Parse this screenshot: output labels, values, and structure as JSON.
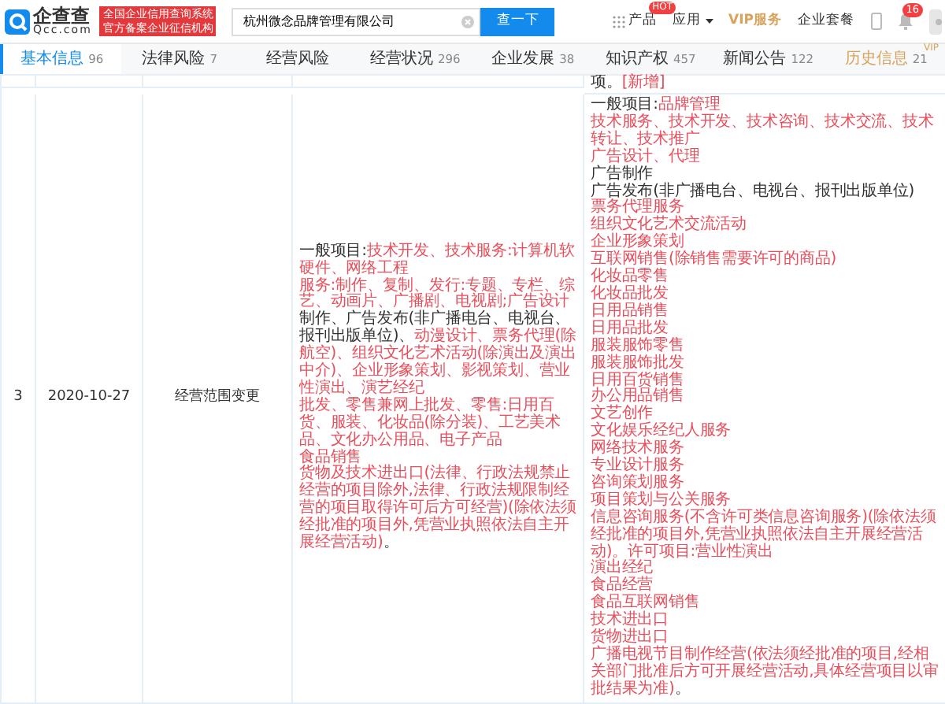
{
  "header": {
    "logo": {
      "name": "企查查",
      "domain": "Qcc.com"
    },
    "slogan": [
      "全国企业信用查询系统",
      "官方备案企业征信机构"
    ],
    "search": {
      "value": "杭州微念品牌管理有限公司",
      "button": "查一下"
    },
    "nav": [
      {
        "kind": "product",
        "label": "产品",
        "badge": "HOT"
      },
      {
        "kind": "dropdown",
        "label": "应用"
      },
      {
        "kind": "vip",
        "label": "VIP服务"
      },
      {
        "kind": "plain",
        "label": "企业套餐"
      }
    ],
    "notifications": "16"
  },
  "tabs": [
    {
      "label": "基本信息",
      "count": "96",
      "selected": true,
      "vip": false
    },
    {
      "label": "法律风险",
      "count": "7",
      "selected": false,
      "vip": false
    },
    {
      "label": "经营风险",
      "selected": false,
      "vip": false
    },
    {
      "label": "经营状况",
      "count": "296",
      "selected": false,
      "vip": false
    },
    {
      "label": "企业发展",
      "count": "38",
      "selected": false,
      "vip": false
    },
    {
      "label": "知识产权",
      "count": "457",
      "selected": false,
      "vip": false
    },
    {
      "label": "新闻公告",
      "count": "122",
      "selected": false,
      "vip": false
    },
    {
      "label": "历史信息",
      "count": "21",
      "selected": false,
      "vip": true,
      "badge": "VIP"
    }
  ],
  "table": {
    "previous_row": {
      "after": [
        [
          {
            "text": "项。",
            "changed": false
          },
          {
            "text": "[新增]",
            "changed": true
          }
        ]
      ]
    },
    "rows": [
      {
        "index": "3",
        "date": "2020-10-27",
        "type": "经营范围变更",
        "before": [
          [
            {
              "text": "一般项目:",
              "changed": false
            },
            {
              "text": "技术开发、技术服务:计算机软硬件、网络工程",
              "changed": true
            }
          ],
          [
            {
              "text": "服务:制作、复制、发行:专题、专栏、综艺、动画片、广播剧、电视剧;广告设计",
              "changed": true
            },
            {
              "text": "制作、广告发布(非广播电台、电视台、报刊出版单位)、",
              "changed": false
            },
            {
              "text": "动漫设计、票务代理(除航空)、组织文化艺术活动(除演出及演出中介)、企业形象策划、影视策划、营业性演出、演艺经纪",
              "changed": true
            }
          ],
          [
            {
              "text": "批发、零售兼网上批发、零售:日用百货、服装、化妆品(除分装)、工艺美术品、文化办公用品、电子产品",
              "changed": true
            }
          ],
          [
            {
              "text": "食品销售",
              "changed": true
            }
          ],
          [
            {
              "text": "货物及技术进出口(法律、行政法规禁止经营的项目除外,法律、行政法规限制经营的项目取得许可后方可经营)(除依法须经批准的项目外,凭营业执照依法自主开展经营活动)",
              "changed": true
            },
            {
              "text": "。",
              "changed": false
            }
          ]
        ],
        "after": [
          [
            {
              "text": "一般项目:",
              "changed": false
            },
            {
              "text": "品牌管理",
              "changed": true
            }
          ],
          [
            {
              "text": "技术服务、技术开发、技术咨询、技术交流、技术转让、技术推广",
              "changed": true
            }
          ],
          [
            {
              "text": "广告设计、代理",
              "changed": true
            }
          ],
          [
            {
              "text": "广告制作",
              "changed": false
            }
          ],
          [
            {
              "text": "广告发布(非广播电台、电视台、报刊出版单位)",
              "changed": false
            }
          ],
          [
            {
              "text": "票务代理服务",
              "changed": true
            }
          ],
          [
            {
              "text": "组织文化艺术交流活动",
              "changed": true
            }
          ],
          [
            {
              "text": "企业形象策划",
              "changed": true
            }
          ],
          [
            {
              "text": "互联网销售(除销售需要许可的商品)",
              "changed": true
            }
          ],
          [
            {
              "text": "化妆品零售",
              "changed": true
            }
          ],
          [
            {
              "text": "化妆品批发",
              "changed": true
            }
          ],
          [
            {
              "text": "日用品销售",
              "changed": true
            }
          ],
          [
            {
              "text": "日用品批发",
              "changed": true
            }
          ],
          [
            {
              "text": "服装服饰零售",
              "changed": true
            }
          ],
          [
            {
              "text": "服装服饰批发",
              "changed": true
            }
          ],
          [
            {
              "text": "日用百货销售",
              "changed": true
            }
          ],
          [
            {
              "text": "办公用品销售",
              "changed": true
            }
          ],
          [
            {
              "text": "文艺创作",
              "changed": true
            }
          ],
          [
            {
              "text": "文化娱乐经纪人服务",
              "changed": true
            }
          ],
          [
            {
              "text": "网络技术服务",
              "changed": true
            }
          ],
          [
            {
              "text": "专业设计服务",
              "changed": true
            }
          ],
          [
            {
              "text": "咨询策划服务",
              "changed": true
            }
          ],
          [
            {
              "text": "项目策划与公关服务",
              "changed": true
            }
          ],
          [
            {
              "text": "信息咨询服务(不含许可类信息咨询服务)(除依法须经批准的项目外,凭营业执照依法自主开展经营活动)。许可项目:营业性演出",
              "changed": true
            }
          ],
          [
            {
              "text": "演出经纪",
              "changed": true
            }
          ],
          [
            {
              "text": "食品经营",
              "changed": true
            }
          ],
          [
            {
              "text": "食品互联网销售",
              "changed": true
            }
          ],
          [
            {
              "text": "技术进出口",
              "changed": true
            }
          ],
          [
            {
              "text": "货物进出口",
              "changed": true
            }
          ],
          [
            {
              "text": "广播电视节目制作经营(依法须经批准的项目,经相关部门批准后方可开展经营活动,具体经营项目以审批结果为准)",
              "changed": true
            },
            {
              "text": "。",
              "changed": false
            }
          ]
        ]
      }
    ]
  }
}
